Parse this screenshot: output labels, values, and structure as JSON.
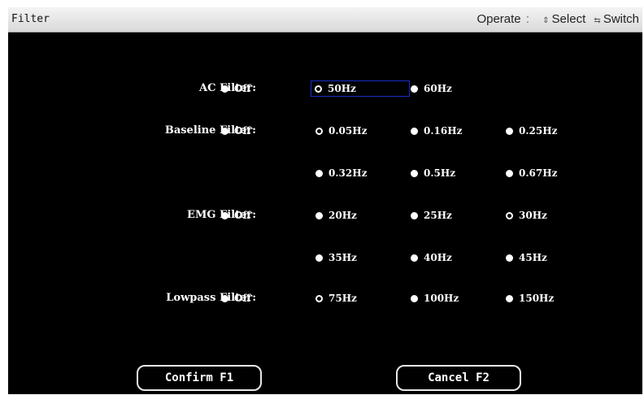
{
  "header": {
    "title": "Filter",
    "operate_label": "Operate",
    "operate_sep": ":",
    "select_icon": "up-down-arrows-icon",
    "select_label": "Select",
    "switch_icon": "left-right-arrows-icon",
    "switch_label": "Switch"
  },
  "filters": {
    "ac": {
      "label": "AC Filter:",
      "off": "Off",
      "options": [
        "50Hz",
        "60Hz"
      ],
      "selected": "50Hz"
    },
    "baseline": {
      "label": "Baseline Filter:",
      "off": "Off",
      "options": [
        "0.05Hz",
        "0.16Hz",
        "0.25Hz",
        "0.32Hz",
        "0.5Hz",
        "0.67Hz"
      ],
      "selected": "0.05Hz"
    },
    "emg": {
      "label": "EMG Filter:",
      "off": "Off",
      "options": [
        "20Hz",
        "25Hz",
        "30Hz",
        "35Hz",
        "40Hz",
        "45Hz"
      ],
      "selected": "30Hz"
    },
    "lowpass": {
      "label": "Lowpass Filter:",
      "off": "Off",
      "options": [
        "75Hz",
        "100Hz",
        "150Hz"
      ],
      "selected": "75Hz"
    }
  },
  "buttons": {
    "confirm": "Confirm F1",
    "cancel": "Cancel F2"
  },
  "colors": {
    "background": "#000000",
    "text": "#ffffff",
    "focus_border": "#1630c8",
    "titlebar": "#e6e6e6"
  }
}
